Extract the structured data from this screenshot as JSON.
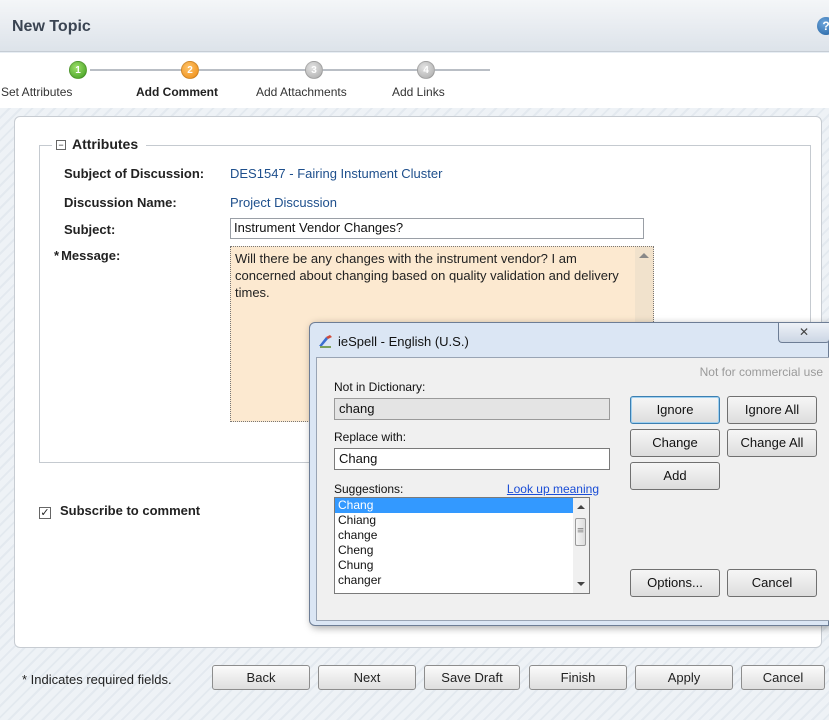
{
  "header": {
    "title": "New Topic",
    "help_glyph": "?"
  },
  "wizard": {
    "steps": [
      {
        "number": "1",
        "label": "Set Attributes",
        "state": "done"
      },
      {
        "number": "2",
        "label": "Add Comment",
        "state": "active"
      },
      {
        "number": "3",
        "label": "Add Attachments",
        "state": "todo"
      },
      {
        "number": "4",
        "label": "Add Links",
        "state": "todo"
      }
    ]
  },
  "attributes": {
    "legend": "Attributes",
    "toggle_glyph": "−",
    "subject_of_discussion_label": "Subject of Discussion:",
    "subject_of_discussion_value": "DES1547 - Fairing Instument Cluster",
    "discussion_name_label": "Discussion Name:",
    "discussion_name_value": "Project Discussion",
    "subject_label": "Subject:",
    "subject_value": "Instrument Vendor Changes?",
    "message_label": "Message:",
    "required_star": "*",
    "message_value": "Will there be any changes with the instrument vendor? I am concerned about changing based on quality validation and delivery times."
  },
  "subscribe": {
    "label": "Subscribe to comment",
    "checked_glyph": "✓",
    "checked": true
  },
  "footer": {
    "required_note": "* Indicates required fields.",
    "buttons": {
      "back": "Back",
      "next": "Next",
      "save_draft": "Save Draft",
      "finish": "Finish",
      "apply": "Apply",
      "cancel": "Cancel"
    }
  },
  "spell_dialog": {
    "title": "ieSpell - English (U.S.)",
    "close_glyph": "✕",
    "commercial_note": "Not for commercial use",
    "not_in_dictionary_label": "Not in Dictionary:",
    "not_in_dictionary_value": "chang",
    "replace_with_label": "Replace with:",
    "replace_with_value": "Chang",
    "suggestions_label": "Suggestions:",
    "lookup_link": "Look up meaning",
    "suggestions": [
      "Chang",
      "Chiang",
      "change",
      "Cheng",
      "Chung",
      "changer"
    ],
    "selected_suggestion_index": 0,
    "buttons": {
      "ignore": "Ignore",
      "ignore_all": "Ignore All",
      "change": "Change",
      "change_all": "Change All",
      "add": "Add",
      "options": "Options...",
      "cancel": "Cancel"
    }
  },
  "colors": {
    "link_blue": "#1e4f8c",
    "message_bg": "#fce9d0",
    "step_done": "#3c9a1c",
    "step_active": "#ee8a10",
    "step_todo": "#a8a8a8",
    "selection": "#3399ff"
  }
}
